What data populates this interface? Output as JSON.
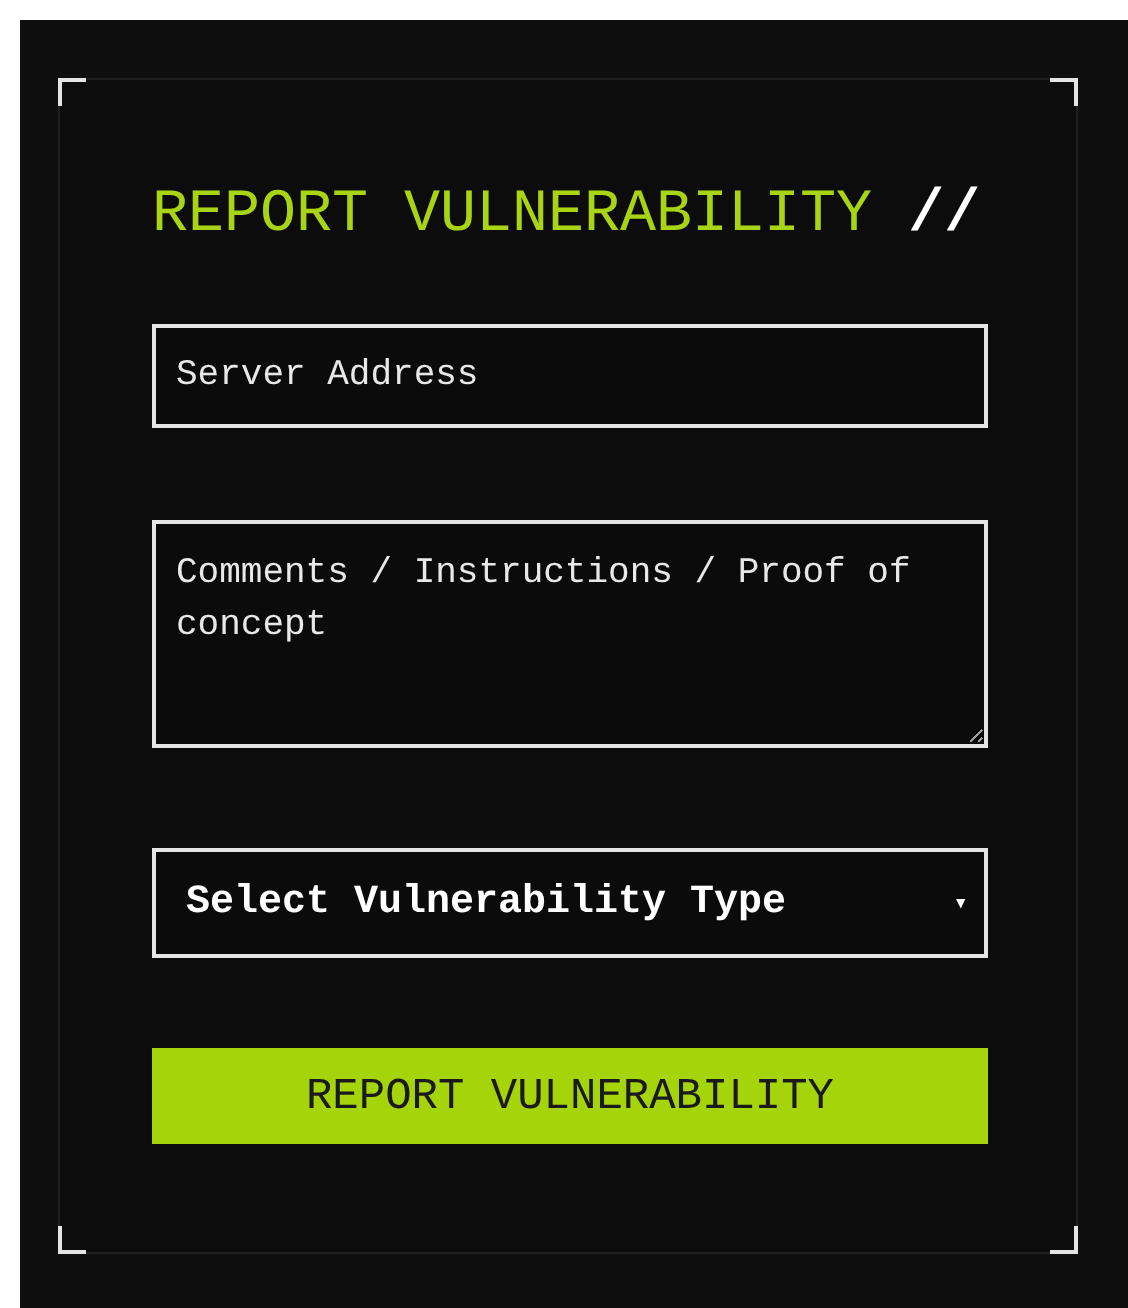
{
  "title": {
    "text": "REPORT VULNERABILITY",
    "suffix": "//"
  },
  "server_field": {
    "placeholder": "Server Address"
  },
  "comments_field": {
    "placeholder": "Comments / Instructions / Proof of concept"
  },
  "type_select": {
    "value": "Select Vulnerability Type",
    "caret": "▾"
  },
  "submit_button": {
    "label": "REPORT VULNERABILITY"
  }
}
